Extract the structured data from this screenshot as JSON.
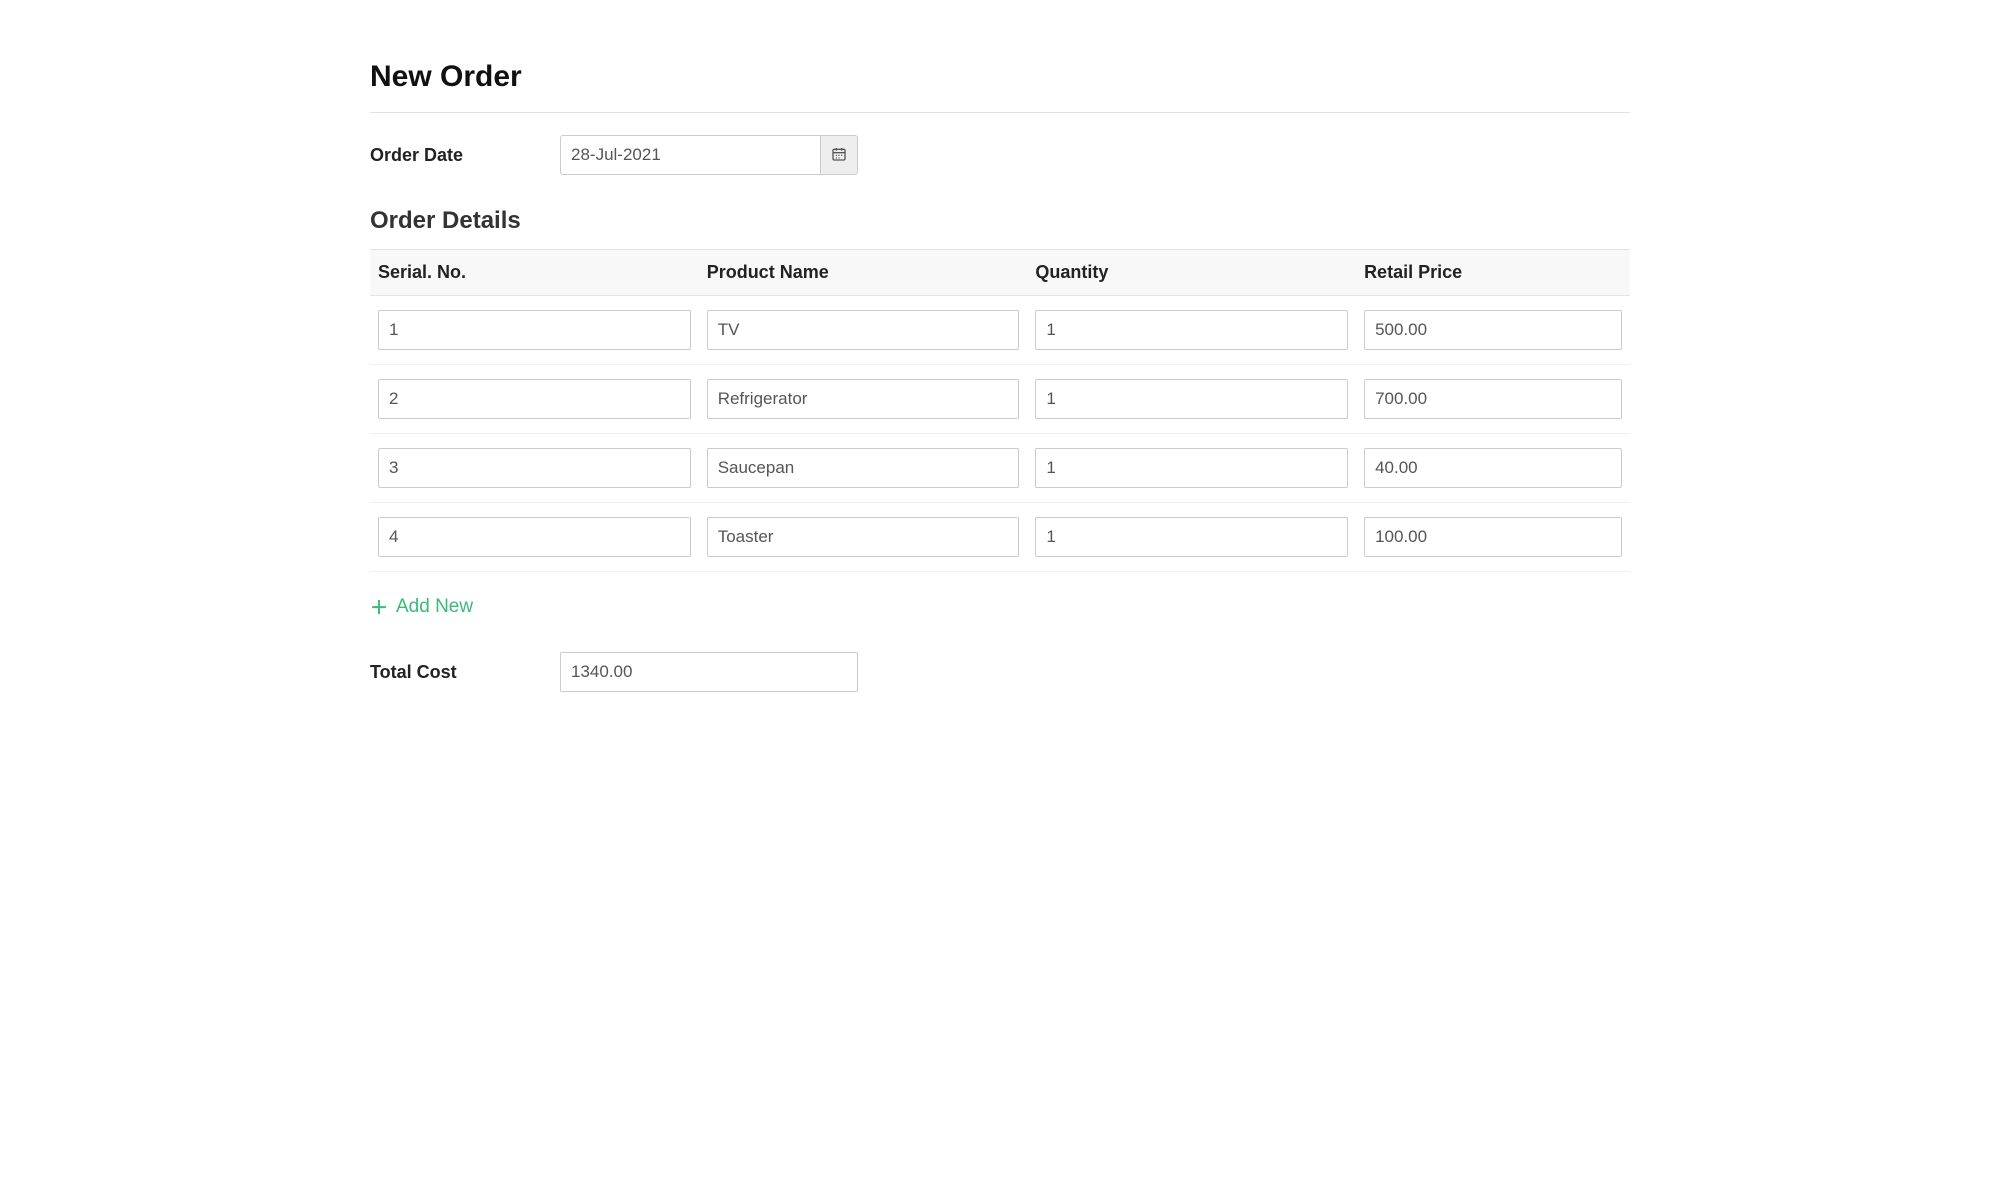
{
  "page_title": "New Order",
  "order_date": {
    "label": "Order Date",
    "value": "28-Jul-2021"
  },
  "details": {
    "title": "Order Details",
    "columns": {
      "serial": "Serial. No.",
      "product": "Product Name",
      "qty": "Quantity",
      "price": "Retail Price"
    },
    "rows": [
      {
        "serial": "1",
        "product": "TV",
        "qty": "1",
        "price": "500.00"
      },
      {
        "serial": "2",
        "product": "Refrigerator",
        "qty": "1",
        "price": "700.00"
      },
      {
        "serial": "3",
        "product": "Saucepan",
        "qty": "1",
        "price": "40.00"
      },
      {
        "serial": "4",
        "product": "Toaster",
        "qty": "1",
        "price": "100.00"
      }
    ]
  },
  "add_new_label": "Add New",
  "total": {
    "label": "Total Cost",
    "value": "1340.00"
  }
}
